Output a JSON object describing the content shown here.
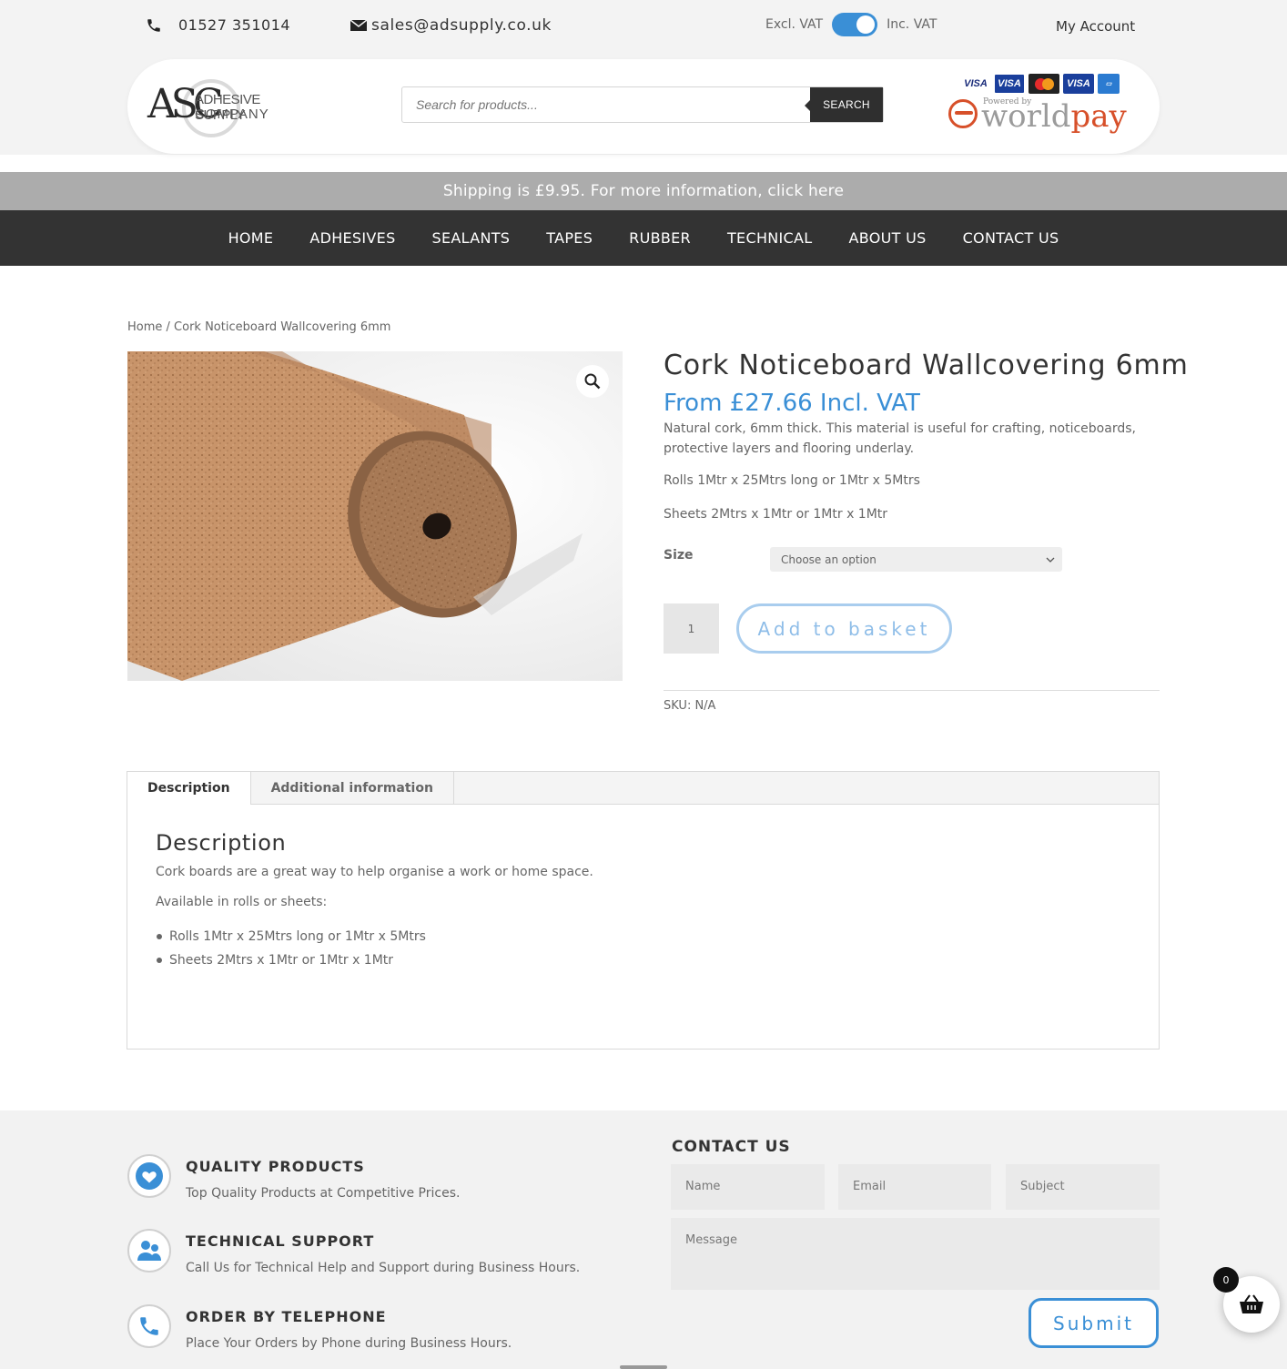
{
  "topbar": {
    "phone": "01527 351014",
    "email": "sales@adsupply.co.uk",
    "vat_excl": "Excl. VAT",
    "vat_incl": "Inc. VAT",
    "vat_toggle_on": true,
    "my_account": "My Account"
  },
  "logo": {
    "mark": "ASC",
    "line1": "ADHESIVE SUPPLY",
    "line2": "COMPANY"
  },
  "search": {
    "placeholder": "Search for products...",
    "button": "SEARCH"
  },
  "payment": {
    "cards": [
      "VISA",
      "VISA",
      "VISA"
    ],
    "powered_by": "Powered by",
    "brand_world": "world",
    "brand_pay": "pay"
  },
  "shipping_banner": "Shipping is £9.95. For more information, click here",
  "nav": [
    "HOME",
    "ADHESIVES",
    "SEALANTS",
    "TAPES",
    "RUBBER",
    "TECHNICAL",
    "ABOUT US",
    "CONTACT US"
  ],
  "breadcrumb": {
    "home": "Home",
    "sep": " / ",
    "current": "Cork Noticeboard Wallcovering 6mm"
  },
  "product": {
    "title": "Cork Noticeboard Wallcovering 6mm",
    "price": "From £27.66 Incl. VAT",
    "short_desc": "Natural cork, 6mm thick. This material is useful for crafting, noticeboards, protective layers and flooring underlay.",
    "rolls": "Rolls 1Mtr x 25Mtrs long or 1Mtr x 5Mtrs",
    "sheets": "Sheets 2Mtrs x 1Mtr or 1Mtr x 1Mtr",
    "size_label": "Size",
    "size_select": "Choose an option",
    "quantity": "1",
    "add_to_basket": "Add to basket",
    "sku": "SKU: N/A"
  },
  "tabs": {
    "items": [
      "Description",
      "Additional information"
    ],
    "active": "Description",
    "heading": "Description",
    "p1": "Cork boards are a great way to help organise a work or home space.",
    "p2": "Available in rolls or sheets:",
    "bullets": [
      "Rolls 1Mtr x 25Mtrs long or 1Mtr x 5Mtrs",
      "Sheets 2Mtrs x 1Mtr or 1Mtr x 1Mtr"
    ]
  },
  "footer": {
    "features": [
      {
        "icon": "heart-icon",
        "title": "QUALITY PRODUCTS",
        "desc": "Top Quality Products at Competitive Prices."
      },
      {
        "icon": "people-icon",
        "title": "TECHNICAL SUPPORT",
        "desc": "Call Us for Technical Help and Support during Business Hours."
      },
      {
        "icon": "phone-icon",
        "title": "ORDER BY TELEPHONE",
        "desc": "Place Your Orders by Phone during Business Hours."
      }
    ],
    "contact_heading": "CONTACT US",
    "name_placeholder": "Name",
    "email_placeholder": "Email",
    "subject_placeholder": "Subject",
    "message_placeholder": "Message",
    "submit": "Submit"
  },
  "cart": {
    "count": "0"
  },
  "colors": {
    "accent": "#3a8fd6",
    "nav_bg": "#333333",
    "ship_bg": "#acacac"
  }
}
